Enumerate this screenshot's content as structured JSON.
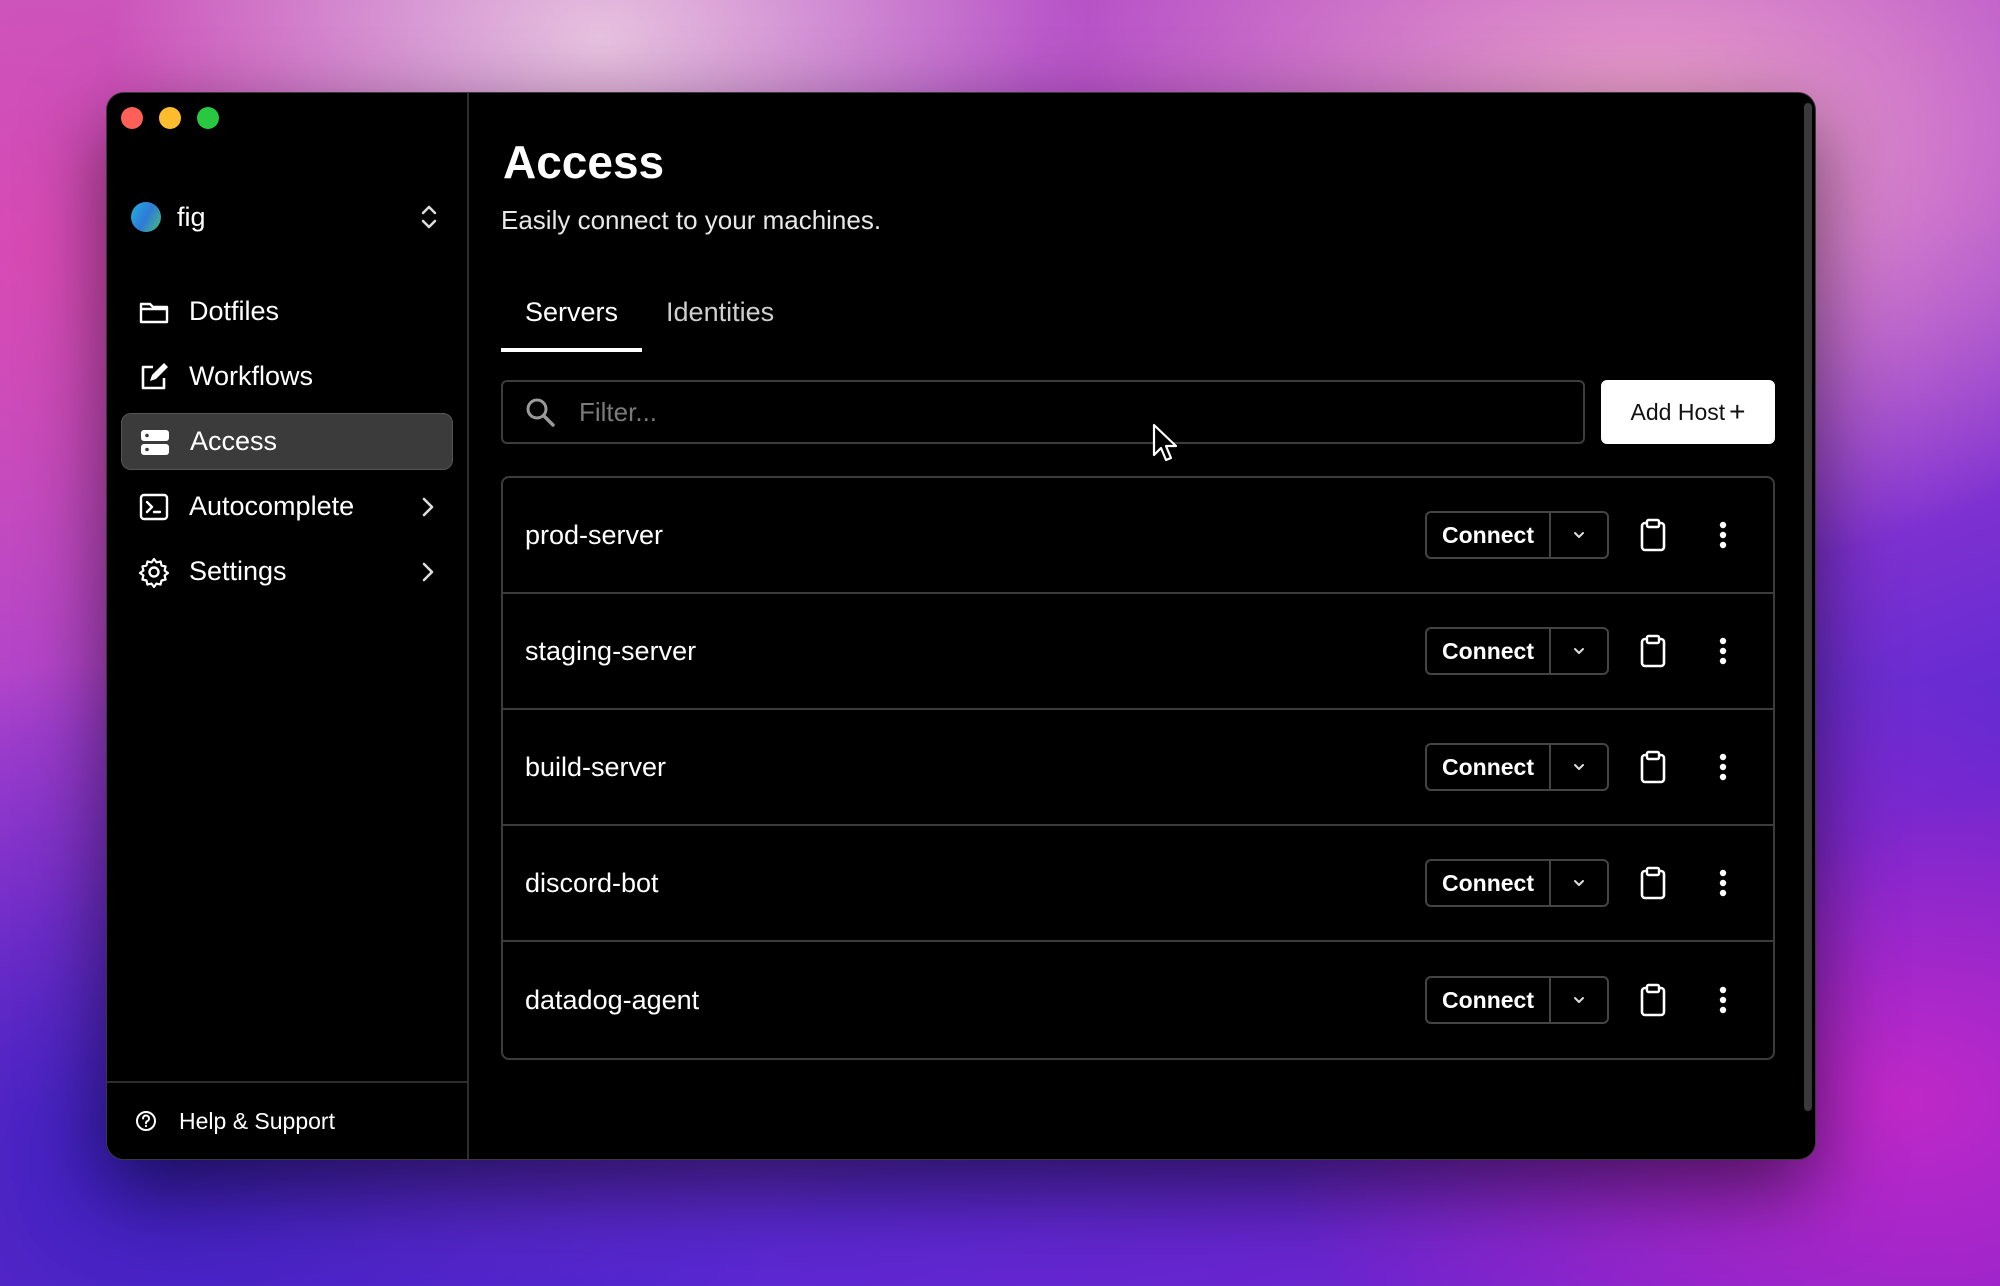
{
  "sidebar": {
    "workspace": {
      "name": "fig"
    },
    "items": [
      {
        "label": "Dotfiles",
        "icon": "folder-icon"
      },
      {
        "label": "Workflows",
        "icon": "edit-icon"
      },
      {
        "label": "Access",
        "icon": "server-icon",
        "active": true
      },
      {
        "label": "Autocomplete",
        "icon": "terminal-icon",
        "has_submenu": true
      },
      {
        "label": "Settings",
        "icon": "gear-icon",
        "has_submenu": true
      }
    ],
    "footer": {
      "label": "Help & Support"
    }
  },
  "main": {
    "title": "Access",
    "subtitle": "Easily connect to your machines.",
    "tabs": [
      {
        "label": "Servers",
        "active": true
      },
      {
        "label": "Identities",
        "active": false
      }
    ],
    "filter": {
      "placeholder": "Filter...",
      "value": ""
    },
    "add_host": {
      "label": "Add Host",
      "plus": "+"
    },
    "servers": [
      {
        "name": "prod-server",
        "connect_label": "Connect"
      },
      {
        "name": "staging-server",
        "connect_label": "Connect"
      },
      {
        "name": "build-server",
        "connect_label": "Connect"
      },
      {
        "name": "discord-bot",
        "connect_label": "Connect"
      },
      {
        "name": "datadog-agent",
        "connect_label": "Connect"
      }
    ]
  },
  "colors": {
    "window_bg": "#000000",
    "active_nav_bg": "#3b3b3b",
    "border": "#3c3c3c",
    "primary_button_bg": "#ffffff"
  }
}
